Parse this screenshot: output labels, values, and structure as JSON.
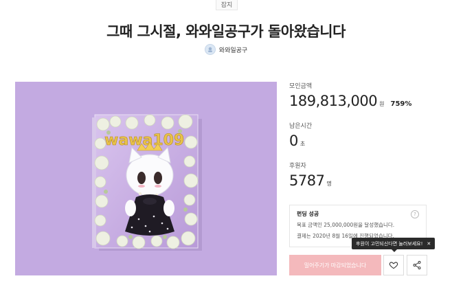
{
  "header": {
    "category": "잡지",
    "title": "그때 그시절, 와와일공구가 돌아왔습니다",
    "creator": "와와일공구"
  },
  "hero": {
    "product_text": "wawa109"
  },
  "stats": {
    "raised_label": "모인금액",
    "raised_value": "189,813,000",
    "raised_unit": "원",
    "raised_percent": "759%",
    "time_label": "남은시간",
    "time_value": "0",
    "time_unit": "초",
    "backers_label": "후원자",
    "backers_value": "5787",
    "backers_unit": "명"
  },
  "funding": {
    "status": "펀딩 성공",
    "goal_line": "목표 금액인 25,000,000원을 달성했습니다.",
    "payment_line": "결제는 2020년 8월 16일에 진행되었습니다."
  },
  "tooltip": {
    "text": "후원이 고민되신다면 눌러보세요!"
  },
  "actions": {
    "cta_label": "밀어주기가 마감되었습니다"
  },
  "colors": {
    "hero_bg": "#c3aae1",
    "cta_bg": "#f4b9bc"
  }
}
